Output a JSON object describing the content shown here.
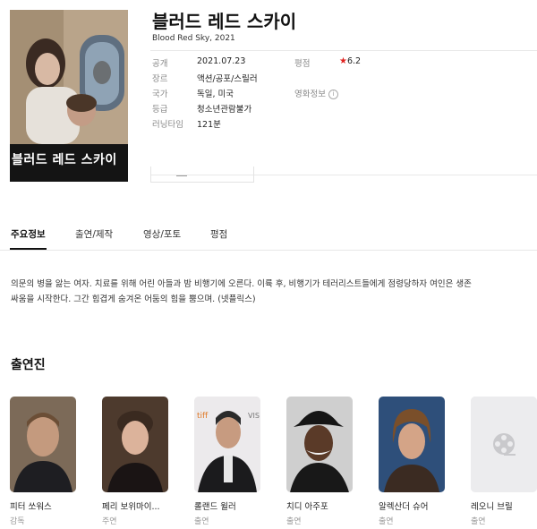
{
  "movie": {
    "title": "블러드 레드 스카이",
    "subtitle": "Blood Red Sky, 2021",
    "poster_title": "블러드 레드 스카이"
  },
  "info": {
    "release_label": "공개",
    "release_value": "2021.07.23",
    "genre_label": "장르",
    "genre_value": "액션/공포/스릴러",
    "country_label": "국가",
    "country_value": "독일, 미국",
    "grade_label": "등급",
    "grade_value": "청소년관람불가",
    "runtime_label": "러닝타임",
    "runtime_value": "121분",
    "rating_label": "평점",
    "rating_value": "6.2",
    "movieinfo_label": "영화정보",
    "info_icon": "i"
  },
  "tabs": [
    "주요정보",
    "출연/제작",
    "영상/포토",
    "평점"
  ],
  "synopsis": "의문의 병을 앓는 여자. 치료를 위해 어린 아들과 밤 비행기에 오른다. 이륙 후, 비행기가 테러리스트들에게 점령당하자 여인은 생존 싸움을 시작한다. 그간 힘겹게 숨겨온 어둠의 힘을 뿜으며. (넷플릭스)",
  "cast_section_title": "출연진",
  "cast": [
    {
      "name": "피터 쏘워스",
      "role": "감독"
    },
    {
      "name": "페리 보위마이...",
      "role": "주연"
    },
    {
      "name": "롤랜드 윌러",
      "role": "출연"
    },
    {
      "name": "치디 아주포",
      "role": "출연"
    },
    {
      "name": "알렉산더 슈어",
      "role": "출연"
    },
    {
      "name": "레오니 브릴",
      "role": "출연"
    }
  ],
  "colors": {
    "accent": "#e0221f",
    "text": "#222222",
    "muted": "#888888"
  }
}
